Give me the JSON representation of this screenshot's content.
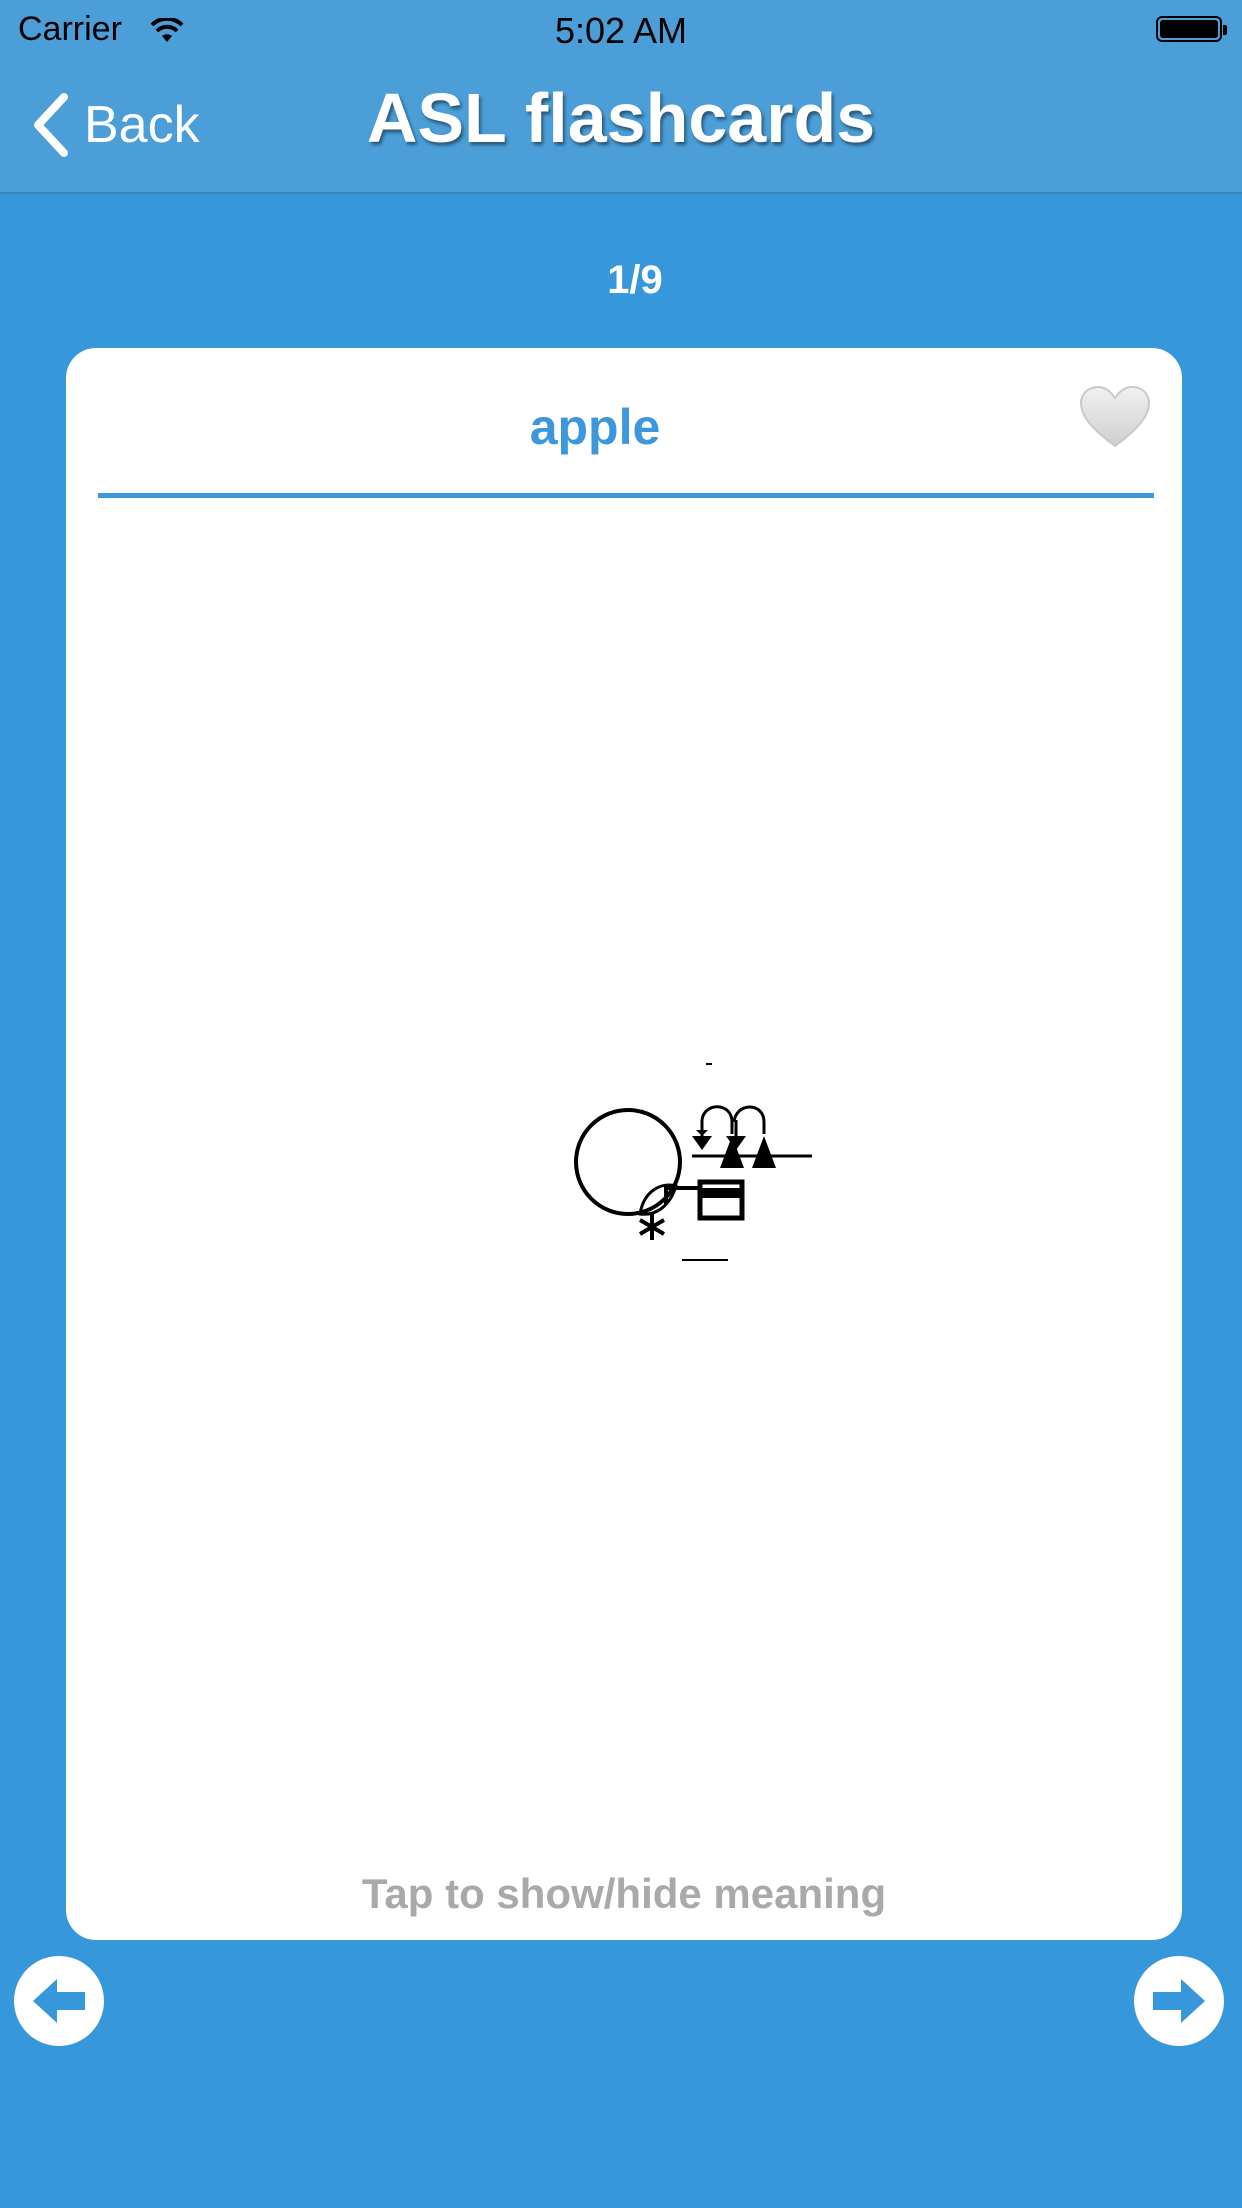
{
  "status_bar": {
    "carrier": "Carrier",
    "time": "5:02 AM"
  },
  "nav": {
    "back_label": "Back",
    "title": "ASL flashcards"
  },
  "counter": "1/9",
  "card": {
    "word": "apple",
    "hint": "Tap to show/hide meaning",
    "favorite_icon": "heart-icon",
    "sign_image": "signwriting-apple"
  },
  "controls": {
    "prev_icon": "arrow-left-icon",
    "next_icon": "arrow-right-icon"
  },
  "colors": {
    "background": "#3797db",
    "navbar": "#4b9ed8",
    "accent": "#3c97dc",
    "hint": "#a9a9a9"
  }
}
